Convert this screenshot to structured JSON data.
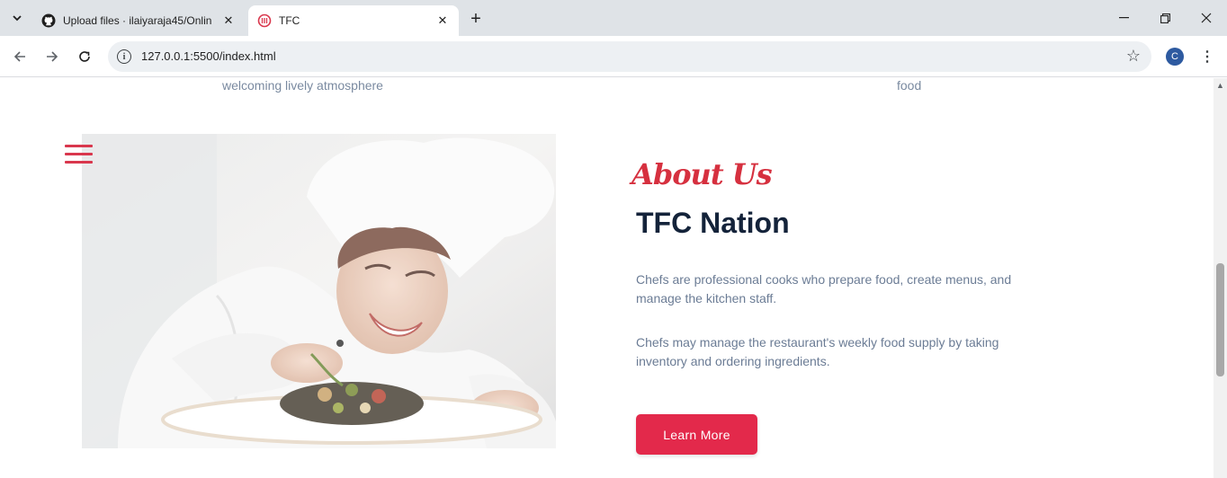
{
  "browser": {
    "tabs": [
      {
        "title": "Upload files · ilaiyaraja45/Onlin",
        "favicon": "github-icon"
      },
      {
        "title": "TFC",
        "favicon": "restaurant-logo-icon"
      }
    ],
    "url": "127.0.0.1:5500/index.html",
    "profile_initial": "C"
  },
  "page": {
    "top_left_text": "welcoming lively atmosphere",
    "top_right_text": "food",
    "about": {
      "label": "About Us",
      "heading": "TFC Nation",
      "paragraphs": [
        "Chefs are professional cooks who prepare food, create menus, and manage the kitchen staff.",
        "Chefs may manage the restaurant's weekly food supply by taking inventory and ordering ingredients."
      ],
      "button_label": "Learn More"
    },
    "colors": {
      "accent": "#e3294b",
      "heading": "#14233a",
      "body_text": "#6b7c95"
    }
  }
}
